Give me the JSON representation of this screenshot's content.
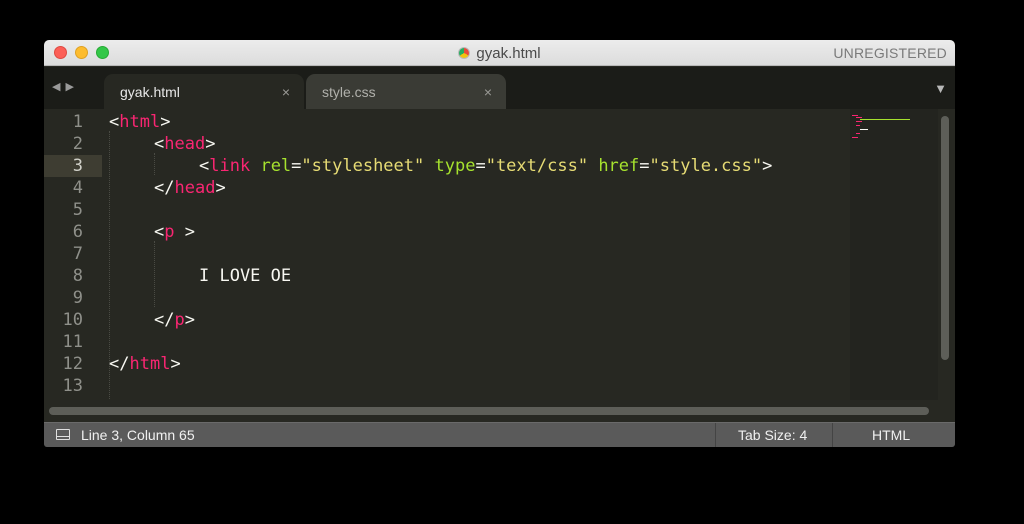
{
  "window": {
    "title": "gyak.html",
    "registration": "UNREGISTERED"
  },
  "tabs": [
    {
      "label": "gyak.html",
      "active": true,
      "close": "×"
    },
    {
      "label": "style.css",
      "active": false,
      "close": "×"
    }
  ],
  "nav": {
    "back": "◀",
    "forward": "▶",
    "menu": "▼"
  },
  "editor": {
    "active_line": 3,
    "line_numbers": [
      "1",
      "2",
      "3",
      "4",
      "5",
      "6",
      "7",
      "8",
      "9",
      "10",
      "11",
      "12",
      "13"
    ],
    "lines": [
      {
        "t1": "<",
        "t2": "html",
        "t3": ">"
      },
      {
        "t1": "<",
        "t2": "head",
        "t3": ">"
      },
      {
        "t1": "<",
        "t2": "link",
        "a1": "rel",
        "eq1": "=",
        "v1": "\"stylesheet\"",
        "a2": "type",
        "eq2": "=",
        "v2": "\"text/css\"",
        "a3": "href",
        "eq3": "=",
        "v3": "\"style.css\"",
        "t3": ">"
      },
      {
        "t1": "</",
        "t2": "head",
        "t3": ">"
      },
      {},
      {
        "t1": "<",
        "t2": "p",
        "t3": " >"
      },
      {},
      {
        "text": "I LOVE OE"
      },
      {},
      {
        "t1": "</",
        "t2": "p",
        "t3": ">"
      },
      {},
      {
        "t1": "</",
        "t2": "html",
        "t3": ">"
      },
      {}
    ]
  },
  "status": {
    "position": "Line 3, Column 65",
    "tab_size": "Tab Size: 4",
    "syntax": "HTML"
  },
  "colors": {
    "tag": "#f92672",
    "attribute": "#a6e22e",
    "string": "#e6db74",
    "background": "#272822"
  },
  "icons": [
    "file-type-icon",
    "back-arrow-icon",
    "forward-arrow-icon",
    "tab-close-icon",
    "tab-list-icon",
    "panel-toggle-icon"
  ]
}
